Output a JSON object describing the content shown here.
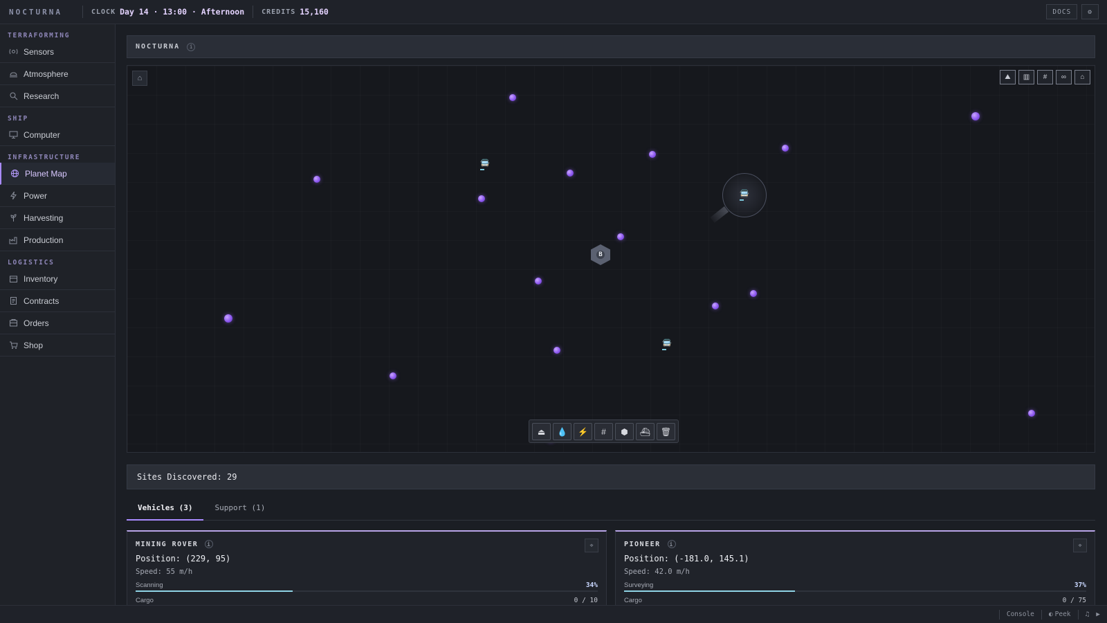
{
  "topbar": {
    "brand": "NOCTURNA",
    "clock_label": "CLOCK",
    "clock_value": "Day 14 · 13:00 · Afternoon",
    "credits_label": "CREDITS",
    "credits_value": "15,160",
    "docs_label": "DOCS",
    "settings_icon": "gear-icon"
  },
  "sidebar": {
    "sections": [
      {
        "title": "TERRAFORMING",
        "items": [
          {
            "label": "Sensors",
            "icon": "sensor-icon"
          },
          {
            "label": "Atmosphere",
            "icon": "cloud-icon"
          },
          {
            "label": "Research",
            "icon": "search-icon"
          }
        ]
      },
      {
        "title": "SHIP",
        "items": [
          {
            "label": "Computer",
            "icon": "monitor-icon"
          }
        ]
      },
      {
        "title": "INFRASTRUCTURE",
        "items": [
          {
            "label": "Planet Map",
            "icon": "globe-icon",
            "active": true
          },
          {
            "label": "Power",
            "icon": "bolt-icon"
          },
          {
            "label": "Harvesting",
            "icon": "plant-icon"
          },
          {
            "label": "Production",
            "icon": "factory-icon"
          }
        ]
      },
      {
        "title": "LOGISTICS",
        "items": [
          {
            "label": "Inventory",
            "icon": "box-icon"
          },
          {
            "label": "Contracts",
            "icon": "document-icon"
          },
          {
            "label": "Orders",
            "icon": "orders-icon"
          },
          {
            "label": "Shop",
            "icon": "cart-icon"
          }
        ]
      }
    ]
  },
  "map": {
    "title": "NOCTURNA",
    "info": "i",
    "base_label": "B",
    "tools": [
      "mountain-icon",
      "chart-icon",
      "grid-icon",
      "link-icon",
      "home-icon"
    ],
    "build_tools": [
      "dome-icon",
      "drop-icon",
      "bolt-icon",
      "grid-icon",
      "hexagon-icon",
      "ship-icon",
      "trash-icon"
    ]
  },
  "sites_bar": {
    "text": "Sites Discovered: 29"
  },
  "tabs": [
    {
      "label": "Vehicles (3)",
      "active": true
    },
    {
      "label": "Support (1)",
      "active": false
    }
  ],
  "vehicles": [
    {
      "name": "MINING ROVER",
      "position": "Position: (229, 95)",
      "speed": "Speed: 55 m/h",
      "status": "Scanning",
      "progress": "34%",
      "progress_value": 0.34,
      "cargo_label": "Cargo",
      "cargo": "0 / 10"
    },
    {
      "name": "PIONEER",
      "position": "Position: (-181.0, 145.1)",
      "speed": "Speed: 42.0 m/h",
      "status": "Surveying",
      "progress": "37%",
      "progress_value": 0.37,
      "cargo_label": "Cargo",
      "cargo": "0 / 75"
    }
  ],
  "bottombar": {
    "console": "Console",
    "peek": "Peek"
  }
}
